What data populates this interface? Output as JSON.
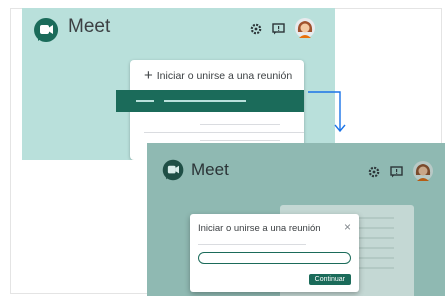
{
  "panel1": {
    "brand": "Meet",
    "menu_item": "Iniciar o unirse a una reunión",
    "plus_glyph": "+"
  },
  "panel2": {
    "brand": "Meet",
    "dialog": {
      "title": "Iniciar o unirse a una reunión",
      "close": "×",
      "button": "Continuar"
    }
  },
  "colors": {
    "panel1_bg": "#b9e0db",
    "panel2_bg": "#8fb9b2",
    "accent": "#1b6b5a",
    "arrow": "#1a73e8"
  },
  "icons": [
    "meet-logo-icon",
    "gear-icon",
    "feedback-icon",
    "avatar"
  ]
}
